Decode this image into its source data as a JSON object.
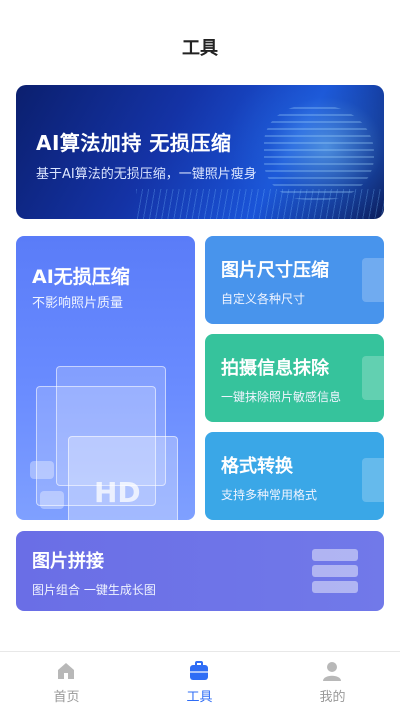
{
  "header": {
    "title": "工具"
  },
  "banner": {
    "title": "AI算法加持  无损压缩",
    "subtitle": "基于AI算法的无损压缩，一键照片瘦身"
  },
  "cards": {
    "ai_compress": {
      "title": "AI无损压缩",
      "subtitle": "不影响照片质量",
      "badge": "HD"
    },
    "size_compress": {
      "title": "图片尺寸压缩",
      "subtitle": "自定义各种尺寸"
    },
    "erase_info": {
      "title": "拍摄信息抹除",
      "subtitle": "一键抹除照片敏感信息"
    },
    "format_convert": {
      "title": "格式转换",
      "subtitle": "支持多种常用格式"
    },
    "stitch": {
      "title": "图片拼接",
      "subtitle": "图片组合 一键生成长图"
    }
  },
  "tabbar": {
    "items": [
      {
        "label": "首页",
        "icon": "home-icon",
        "active": false
      },
      {
        "label": "工具",
        "icon": "toolbox-icon",
        "active": true
      },
      {
        "label": "我的",
        "icon": "user-icon",
        "active": false
      }
    ]
  },
  "colors": {
    "accent": "#2f6df5",
    "ai_card": "#5a7cf8",
    "size_card": "#4894ec",
    "erase_card": "#36c39c",
    "format_card": "#3aa7e7",
    "stitch_card": "#6a6ee6"
  }
}
